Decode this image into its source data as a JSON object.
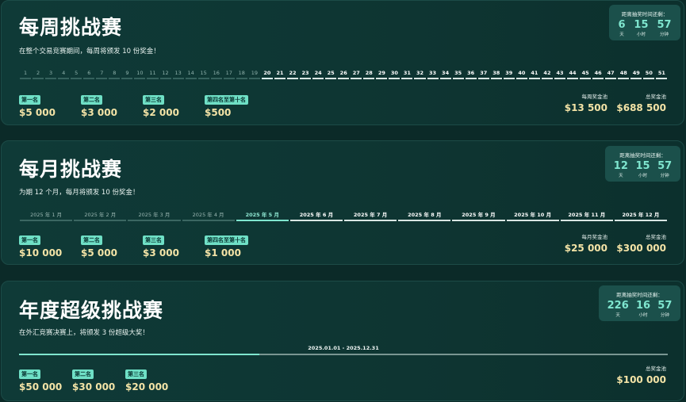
{
  "weekly": {
    "title": "每周挑战赛",
    "subtitle": "在整个交易竞赛期间，每周将颁发 10 份奖金！",
    "countdown": {
      "label": "距离抽奖时间还剩：",
      "days": "6",
      "hours": "15",
      "minutes": "57",
      "day_unit": "天",
      "hour_unit": "小时",
      "minute_unit": "分钟"
    },
    "current_week": 20,
    "weeks": [
      "1",
      "2",
      "3",
      "4",
      "5",
      "6",
      "7",
      "8",
      "9",
      "10",
      "11",
      "12",
      "13",
      "14",
      "15",
      "16",
      "17",
      "18",
      "19",
      "20",
      "21",
      "22",
      "23",
      "24",
      "25",
      "26",
      "27",
      "28",
      "29",
      "30",
      "31",
      "32",
      "33",
      "34",
      "35",
      "36",
      "37",
      "38",
      "39",
      "40",
      "41",
      "42",
      "43",
      "44",
      "45",
      "46",
      "47",
      "48",
      "49",
      "50",
      "51"
    ],
    "prizes": [
      {
        "rank": "第一名",
        "amount": "$5 000"
      },
      {
        "rank": "第二名",
        "amount": "$3 000"
      },
      {
        "rank": "第三名",
        "amount": "$2 000"
      },
      {
        "rank": "第四名至第十名",
        "amount": "$500"
      }
    ],
    "pool": {
      "label": "每周奖金池",
      "amount": "$13 500"
    },
    "total": {
      "label": "总奖金池",
      "amount": "$688 500"
    }
  },
  "monthly": {
    "title": "每月挑战赛",
    "subtitle": "为期 12 个月，每月将颁发 10 份奖金！",
    "countdown": {
      "label": "距离抽奖时间还剩：",
      "days": "12",
      "hours": "15",
      "minutes": "57",
      "day_unit": "天",
      "hour_unit": "小时",
      "minute_unit": "分钟"
    },
    "current_month": 5,
    "months": [
      "2025 年 1 月",
      "2025 年 2 月",
      "2025 年 3 月",
      "2025 年 4 月",
      "2025 年 5 月",
      "2025 年 6 月",
      "2025 年 7 月",
      "2025 年 8 月",
      "2025 年 9 月",
      "2025 年 10 月",
      "2025 年 11 月",
      "2025 年 12 月"
    ],
    "prizes": [
      {
        "rank": "第一名",
        "amount": "$10 000"
      },
      {
        "rank": "第二名",
        "amount": "$5 000"
      },
      {
        "rank": "第三名",
        "amount": "$3 000"
      },
      {
        "rank": "第四名至第十名",
        "amount": "$1 000"
      }
    ],
    "pool": {
      "label": "每月奖金池",
      "amount": "$25 000"
    },
    "total": {
      "label": "总奖金池",
      "amount": "$300 000"
    }
  },
  "yearly": {
    "title": "年度超级挑战赛",
    "subtitle": "在外汇竞赛决赛上，将颁发 3 份超级大奖！",
    "countdown": {
      "label": "距离抽奖时间还剩：",
      "days": "226",
      "hours": "16",
      "minutes": "57",
      "day_unit": "天",
      "hour_unit": "小时",
      "minute_unit": "分钟"
    },
    "range": "2025.01.01 - 2025.12.31",
    "progress": 0.37,
    "prizes": [
      {
        "rank": "第一名",
        "amount": "$50 000"
      },
      {
        "rank": "第二名",
        "amount": "$30 000"
      },
      {
        "rank": "第三名",
        "amount": "$20 000"
      }
    ],
    "total": {
      "label": "总奖金池",
      "amount": "$100 000"
    }
  },
  "colors": {
    "accent": "#7fe6cf",
    "badge": "#6fe0c6",
    "amount": "#f3e3a6",
    "background": "#0b2a28"
  }
}
